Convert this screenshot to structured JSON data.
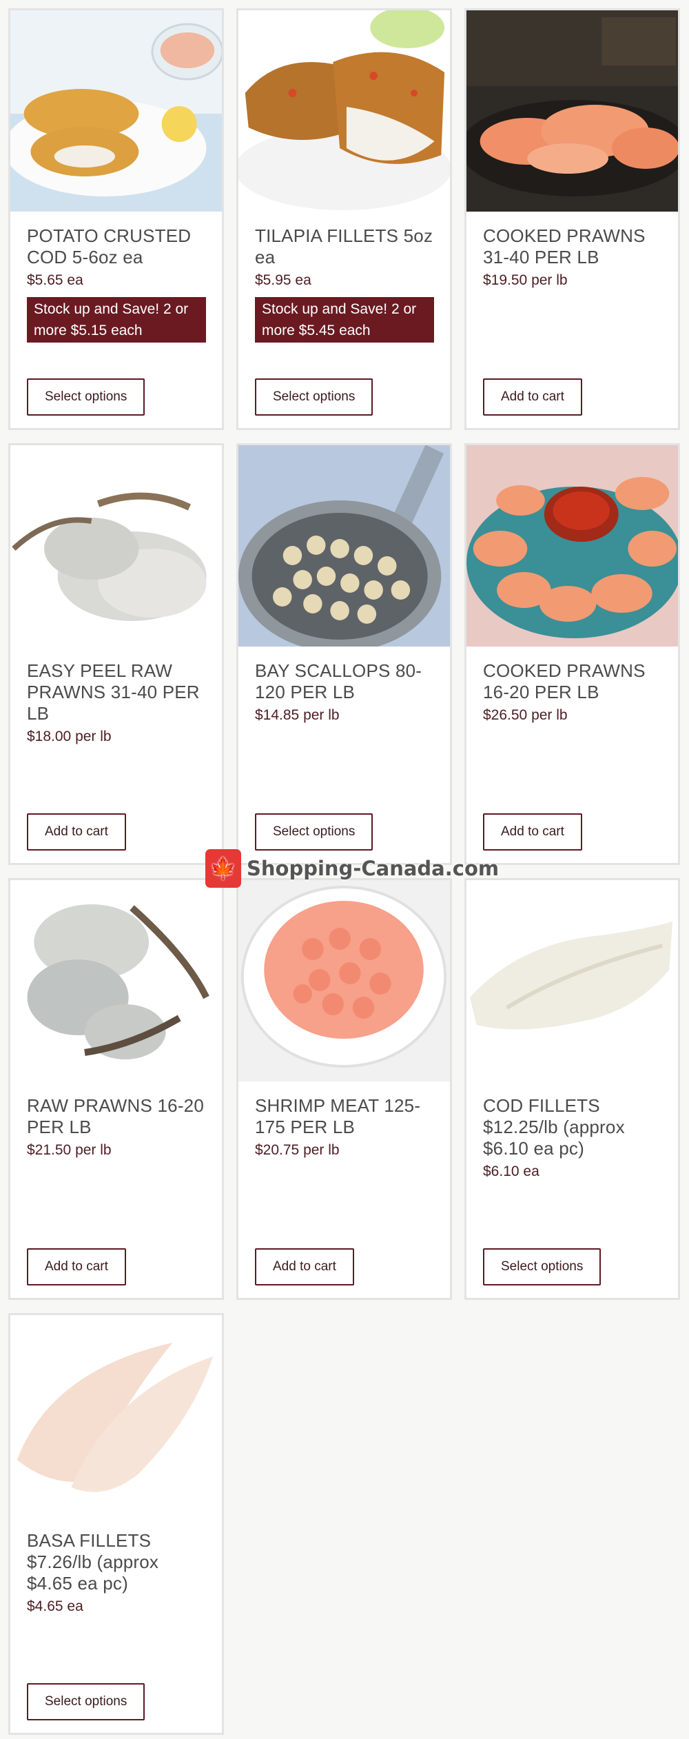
{
  "products": [
    {
      "title": "POTATO CRUSTED COD 5-6oz ea",
      "price": "$5.65 ea",
      "promo": "Stock up and Save! 2 or more $5.15 each",
      "button": "Select options",
      "image": "potato-crusted-cod-image"
    },
    {
      "title": "TILAPIA FILLETS 5oz ea",
      "price": "$5.95 ea",
      "promo": "Stock up and Save! 2 or more $5.45 each",
      "button": "Select options",
      "image": "tilapia-fillets-image"
    },
    {
      "title": "COOKED PRAWNS 31-40 PER LB",
      "price": "$19.50 per lb",
      "button": "Add to cart",
      "image": "cooked-prawns-image"
    },
    {
      "title": "EASY PEEL RAW PRAWNS 31-40 PER LB",
      "price": "$18.00 per lb",
      "button": "Add to cart",
      "image": "raw-prawns-image"
    },
    {
      "title": "BAY SCALLOPS 80-120 PER LB",
      "price": "$14.85 per lb",
      "button": "Select options",
      "image": "bay-scallops-image"
    },
    {
      "title": "COOKED PRAWNS 16-20 PER LB",
      "price": "$26.50 per lb",
      "button": "Add to cart",
      "image": "shrimp-cocktail-image"
    },
    {
      "title": "RAW PRAWNS 16-20 PER LB",
      "price": "$21.50 per lb",
      "button": "Add to cart",
      "image": "raw-prawns-large-image"
    },
    {
      "title": "SHRIMP MEAT 125-175 PER LB",
      "price": "$20.75 per lb",
      "button": "Add to cart",
      "image": "shrimp-meat-bowl-image"
    },
    {
      "title": "COD FILLETS $12.25/lb (approx $6.10 ea pc)",
      "price": "$6.10 ea",
      "button": "Select options",
      "image": "cod-fillets-image"
    },
    {
      "title": "BASA FILLETS $7.26/lb (approx $4.65 ea pc)",
      "price": "$4.65 ea",
      "button": "Select options",
      "image": "basa-fillets-image"
    }
  ],
  "watermark": {
    "text": "Shopping-Canada.com",
    "icon": "maple-leaf-bag-icon"
  },
  "colors": {
    "promo_bg": "#6b1a22",
    "button_border": "#5c1a22",
    "price": "#4b1d22"
  }
}
